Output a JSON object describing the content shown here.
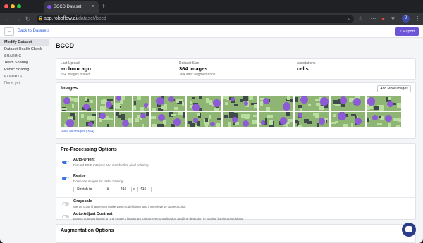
{
  "browser": {
    "tab_title": "BCCD Dataset",
    "url_host": "app.roboflow.ai",
    "url_path": "/dataset/bccd",
    "profile_initial": "J"
  },
  "app_header": {
    "back_label": "Back to Datasets",
    "export_label": "Export"
  },
  "sidebar": {
    "items": [
      "Modify Dataset",
      "Dataset Health Check"
    ],
    "sharing_heading": "SHARING",
    "sharing_items": [
      "Team Sharing",
      "Public Sharing"
    ],
    "exports_heading": "EXPORTS",
    "exports_empty": "None yet"
  },
  "main": {
    "title": "BCCD",
    "stats": {
      "last_upload_label": "Last Upload",
      "last_upload_value": "an hour ago",
      "last_upload_sub": "364 images added",
      "size_label": "Dataset Size",
      "size_value": "364 images",
      "size_sub": "364 after augmentation",
      "annotations_label": "Annotations",
      "annotations_value": "cells"
    },
    "images": {
      "title": "Images",
      "add_more_label": "Add More Images",
      "view_all_label": "View all images (364)"
    },
    "preprocessing": {
      "title": "Pre-Processing Options",
      "options": [
        {
          "name": "Auto-Orient",
          "desc": "Discard EXIF rotations and standardize pixel ordering.",
          "enabled": true
        },
        {
          "name": "Resize",
          "desc": "Downsize images for faster training.",
          "enabled": true
        },
        {
          "name": "Grayscale",
          "desc": "Merge color channels to make your model faster and insensitive to subject color.",
          "enabled": false
        },
        {
          "name": "Auto-Adjust Contrast",
          "desc": "Boosts contrast based on the image's histogram to improve normalization and line detection in varying lighting conditions.",
          "enabled": false
        }
      ],
      "resize_mode": "Stretch to",
      "resize_width": "416",
      "resize_height": "416",
      "times": "x"
    },
    "augmentation": {
      "title": "Augmentation Options"
    }
  },
  "colors": {
    "accent": "#6e55d8",
    "link": "#3b66d6",
    "toggle_on": "#3b72e8"
  }
}
